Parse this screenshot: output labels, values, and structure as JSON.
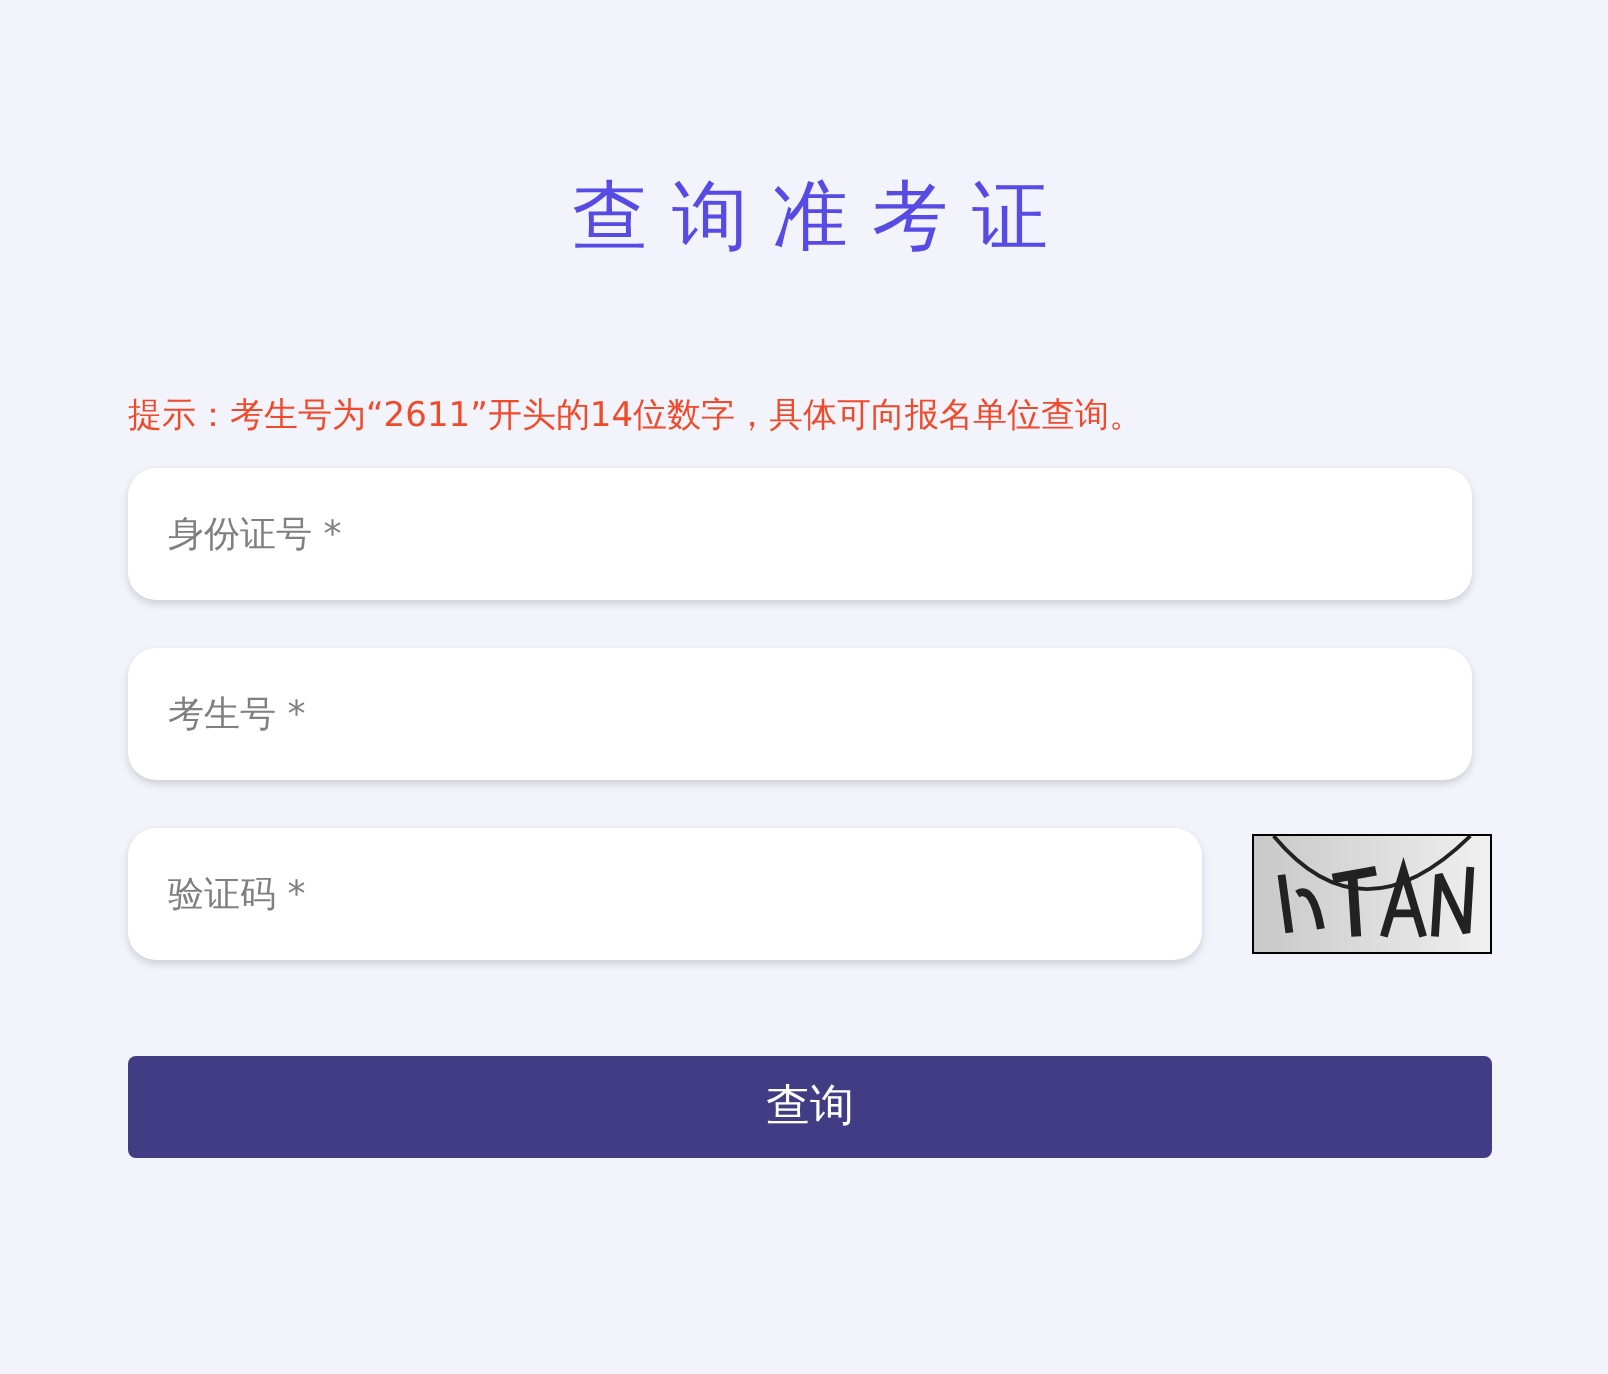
{
  "title": "查询准考证",
  "hint": "提示：考生号为“2611”开头的14位数字，具体可向报名单位查询。",
  "fields": [
    {
      "placeholder": "身份证号 *"
    },
    {
      "placeholder": "考生号 *"
    },
    {
      "placeholder": "验证码 *"
    }
  ],
  "submit_button": "查询"
}
